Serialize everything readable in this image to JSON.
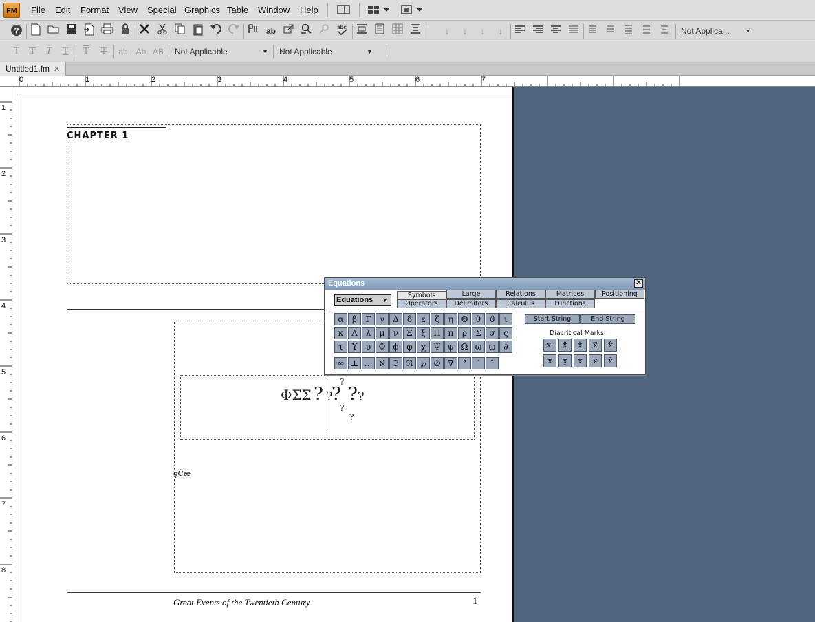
{
  "app": {
    "logo": "FM"
  },
  "menu": [
    "File",
    "Edit",
    "Format",
    "View",
    "Special",
    "Graphics",
    "Table",
    "Window",
    "Help"
  ],
  "toolbar": {
    "tag_combo": "Not Applica...",
    "font_combo_1": "Not Applicable",
    "font_combo_2": "Not Applicable",
    "text_styles": [
      "T",
      "T",
      "T",
      "T",
      "T",
      "T",
      "ab",
      "Ab",
      "AB"
    ],
    "ab_label": "ab"
  },
  "tab": {
    "title": "Untitled1.fm",
    "close": "✕"
  },
  "ruler": {
    "h_numbers": [
      "0",
      "1",
      "2",
      "3",
      "4",
      "5",
      "6",
      "7"
    ],
    "v_numbers": [
      "1",
      "2",
      "3",
      "4",
      "5",
      "6",
      "7",
      "8"
    ]
  },
  "document": {
    "chapter": "CHAPTER 1",
    "equation_text": "ΦΣΣ",
    "placeholder": "?",
    "small_text": "ęĆæ",
    "footer_title": "Great Events of the Twentieth Century",
    "page_number": "1"
  },
  "equations_palette": {
    "title": "Equations",
    "close": "✕",
    "dropdown": "Equations",
    "tabs_row1": [
      "Symbols",
      "Large",
      "Relations",
      "Matrices",
      "Positioning"
    ],
    "tabs_row2": [
      "Operators",
      "Delimiters",
      "Calculus",
      "Functions"
    ],
    "symbols": [
      [
        "α",
        "β",
        "Γ",
        "γ",
        "Δ",
        "δ",
        "ε",
        "ζ",
        "η",
        "Θ",
        "θ",
        "ϑ",
        "ι"
      ],
      [
        "κ",
        "Λ",
        "λ",
        "μ",
        "ν",
        "Ξ",
        "ξ",
        "Π",
        "π",
        "ρ",
        "Σ",
        "σ",
        "ς"
      ],
      [
        "τ",
        "Υ",
        "υ",
        "Φ",
        "ϕ",
        "φ",
        "χ",
        "Ψ",
        "ψ",
        "Ω",
        "ω",
        "ϖ",
        "∂"
      ],
      [
        "∞",
        "⊥",
        "…",
        "ℵ",
        "ℑ",
        "ℜ",
        "℘",
        "∅",
        "∇",
        "°",
        "′",
        "″"
      ]
    ],
    "start_string": "Start String",
    "end_string": "End String",
    "diacritical_label": "Diacritical Marks:",
    "diacritical_row1": [
      "x'",
      "ẍ",
      "x̄",
      "x⃗",
      "x̂"
    ],
    "diacritical_row2": [
      "ẋ",
      "x̰",
      "x̲",
      "x⃑",
      "x̃"
    ]
  }
}
